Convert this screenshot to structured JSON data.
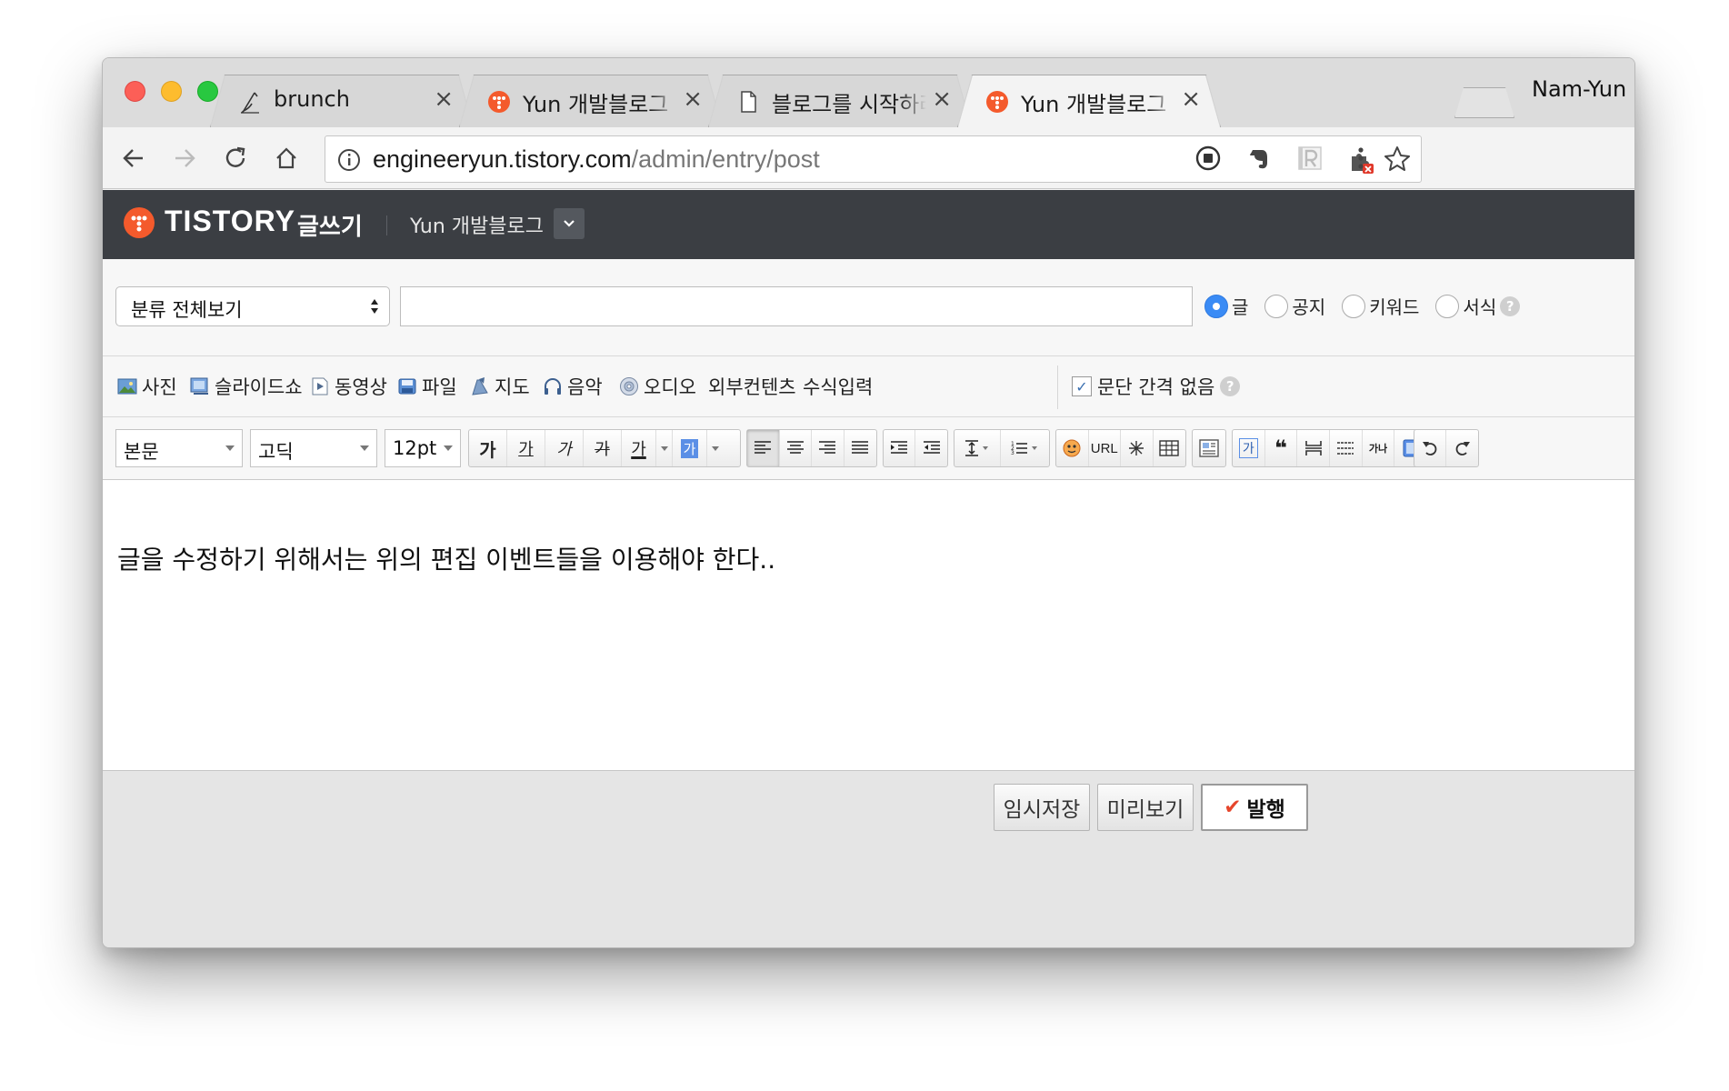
{
  "browser": {
    "profile_name": "Nam-Yun",
    "tabs": [
      {
        "title": "brunch",
        "favicon": "pen-nib-icon",
        "active": false
      },
      {
        "title": "Yun 개발블로그 :: 플러그인",
        "favicon": "tistory-icon",
        "active": false
      },
      {
        "title": "블로그를 시작하려는 당신에게",
        "favicon": "document-icon",
        "active": false
      },
      {
        "title": "Yun 개발블로그 :: 글쓰기",
        "favicon": "tistory-icon",
        "active": true
      }
    ],
    "close_glyph": "×",
    "address": {
      "host": "engineeryun.tistory.com",
      "path": "/admin/entry/post"
    }
  },
  "tistory": {
    "logo_text": "TISTORY",
    "logo_sub": "글쓰기",
    "blog_name": "Yun 개발블로그",
    "brand_color": "#f45a2c",
    "header_color": "#3b3e43"
  },
  "editor": {
    "category_select": "분류 전체보기",
    "title_value": "",
    "post_types": [
      {
        "label": "글",
        "selected": true
      },
      {
        "label": "공지",
        "selected": false
      },
      {
        "label": "키워드",
        "selected": false
      },
      {
        "label": "서식",
        "selected": false
      }
    ],
    "insert_items": [
      {
        "label": "사진",
        "icon": "photo-icon"
      },
      {
        "label": "슬라이드쇼",
        "icon": "slideshow-icon"
      },
      {
        "label": "동영상",
        "icon": "video-icon"
      },
      {
        "label": "파일",
        "icon": "file-icon"
      },
      {
        "label": "지도",
        "icon": "map-icon"
      },
      {
        "label": "음악",
        "icon": "headphones-icon"
      },
      {
        "label": "오디오",
        "icon": "cd-icon"
      },
      {
        "label": "외부컨텐츠",
        "icon": ""
      },
      {
        "label": "수식입력",
        "icon": ""
      }
    ],
    "paragraph_option": {
      "label": "문단 간격 없음",
      "checked": true
    },
    "format": {
      "paragraph_style": "본문",
      "font_family": "고딕",
      "font_size": "12pt",
      "url_label": "URL",
      "bold_glyph": "가",
      "underline_glyph": "가",
      "italic_glyph": "가",
      "strike_glyph": "가",
      "color_glyph": "가",
      "bg_glyph": "가",
      "box_glyph": "가",
      "quote_glyph": "❝",
      "text_size_glyph": "가나"
    },
    "body_text": "글을 수정하기 위해서는 위의 편집 이벤트들을 이용해야 한다..",
    "footer": {
      "save_draft": "임시저장",
      "preview": "미리보기",
      "publish": "발행",
      "publish_check": "✔"
    }
  }
}
